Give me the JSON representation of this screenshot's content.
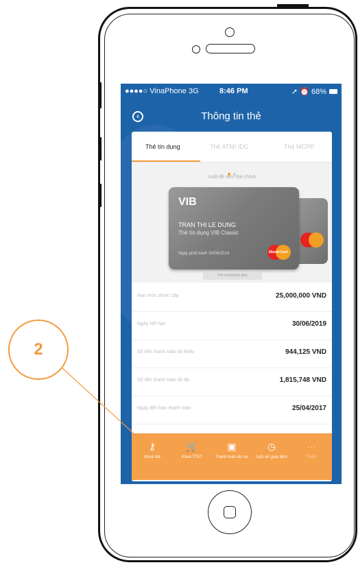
{
  "status_bar": {
    "carrier": "●●●●○ VinaPhone  3G",
    "time": "8:46 PM",
    "battery": "68%"
  },
  "nav": {
    "title": "Thông tin thẻ"
  },
  "tabs": [
    {
      "label": "Thẻ tín dụng",
      "active": true
    },
    {
      "label": "Thẻ ATM/ IDC",
      "active": false
    },
    {
      "label": "Thẻ MCPP",
      "active": false
    }
  ],
  "gallery": {
    "hint": "Vuốt để xem thẻ chính",
    "set_main": "Thẻ chính/mặc định"
  },
  "card": {
    "brand": "VIB",
    "holder": "TRAN THI LE DUNG",
    "type": "Thẻ tín dụng VIB Classic",
    "issue": "Ngày phát hành 30/06/2014",
    "network": "MasterCard"
  },
  "details": [
    {
      "label": "Hạn mức được cấp",
      "value": "25,000,000 VND"
    },
    {
      "label": "Ngày hết hạn",
      "value": "30/06/2019"
    },
    {
      "label": "Số tiền thanh toán tối thiểu",
      "value": "944,125 VND"
    },
    {
      "label": "Số tiền thanh toán tối đa",
      "value": "1,815,748 VND"
    },
    {
      "label": "Ngày đến hạn thanh toán",
      "value": "25/04/2017"
    }
  ],
  "actions": [
    {
      "label": "Khoá thẻ",
      "icon": "key-icon"
    },
    {
      "label": "Khoá TTET",
      "icon": "cart-icon"
    },
    {
      "label": "Thanh toán dư nợ",
      "icon": "money-icon"
    },
    {
      "label": "Lịch sử giao dịch",
      "icon": "history-icon"
    },
    {
      "label": "Thêm",
      "icon": "more-icon"
    }
  ],
  "callout": {
    "number": "2"
  },
  "colors": {
    "accent": "#f39a3c",
    "screen_bg": "#1d63a9",
    "bottom_bar": "#f5a04a"
  }
}
